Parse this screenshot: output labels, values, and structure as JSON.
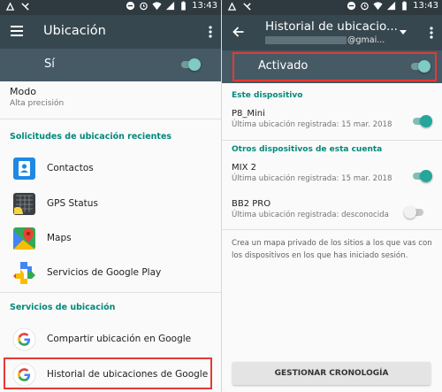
{
  "left": {
    "status_time": "13:43",
    "title": "Ubicación",
    "master_label": "Sí",
    "mode_title": "Modo",
    "mode_value": "Alta precisión",
    "recent_header": "Solicitudes de ubicación recientes",
    "recent_apps": [
      {
        "label": "Contactos",
        "icon": "contacts-icon",
        "color": "#1e88e5"
      },
      {
        "label": "GPS Status",
        "icon": "gps-status-icon",
        "color": "#3a3f44"
      },
      {
        "label": "Maps",
        "icon": "maps-icon",
        "color": "#34a853"
      },
      {
        "label": "Servicios de Google Play",
        "icon": "google-play-services-icon",
        "color": "#4285f4"
      }
    ],
    "services_header": "Servicios de ubicación",
    "services": [
      {
        "label": "Compartir ubicación en Google",
        "icon": "google-g-icon"
      },
      {
        "label": "Historial de ubicaciones de Google",
        "icon": "google-g-icon"
      }
    ]
  },
  "right": {
    "status_time": "13:43",
    "title": "Historial de ubicacio...",
    "account": "@gmai...",
    "master_label": "Activado",
    "this_device_header": "Este dispositivo",
    "devices": [
      {
        "name": "P8_Mini",
        "detail": "Última ubicación registrada: 15 mar. 2018",
        "enabled": true
      }
    ],
    "other_devices_header": "Otros dispositivos de esta cuenta",
    "other_devices": [
      {
        "name": "MIX 2",
        "detail": "Última ubicación registrada: 15 mar. 2018",
        "enabled": true
      },
      {
        "name": "BB2 PRO",
        "detail": "Última ubicación registrada: desconocida",
        "enabled": false
      }
    ],
    "description": "Crea un mapa privado de los sitios a los que vas con los dispositivos en los que has iniciado sesión.",
    "manage_button": "GESTIONAR CRONOLOGÍA"
  },
  "colors": {
    "statusbar": "#2f3a40",
    "appbar": "#37474f",
    "master_bar": "#455a64",
    "accent": "#00897b",
    "highlight": "#e53935"
  }
}
